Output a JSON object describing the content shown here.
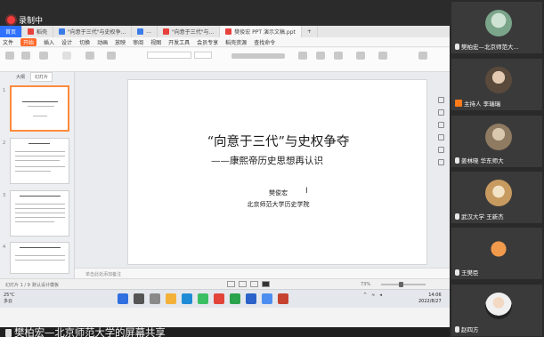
{
  "recording": {
    "label": "录制中"
  },
  "browser_tabs": [
    {
      "label": "首页",
      "icon_color": "#ffffff",
      "home": true
    },
    {
      "label": "稻壳",
      "icon_color": "#e8413c"
    },
    {
      "label": "\"向意于三代\"与史权争...",
      "icon_color": "#3b7be8"
    },
    {
      "label": "...",
      "icon_color": "#3b7be8"
    },
    {
      "label": "\"向意于三代\"与...",
      "icon_color": "#e8413c"
    },
    {
      "label": "樊俊宏 PPT 演示文稿.ppt",
      "icon_color": "#e8413c",
      "active": true
    }
  ],
  "menu": [
    "文件",
    "开始",
    "插入",
    "设计",
    "切换",
    "动画",
    "放映",
    "审阅",
    "视图",
    "开发工具",
    "会员专享",
    "稻壳资源",
    "查找命令"
  ],
  "menu_active": "开始",
  "thumbs_tabs": [
    "大纲",
    "幻灯片"
  ],
  "slide": {
    "title": "“向意于三代”与史权争夺",
    "subtitle": "——康熙帝历史思想再认识",
    "author": "樊俊宏",
    "affiliation": "北京师范大学历史学院"
  },
  "notes_placeholder": "单击此处添加备注",
  "status": {
    "slide_no": "幻灯片 1 / 9",
    "theme": "默认设计模板",
    "zoom": "73%"
  },
  "taskbar": {
    "weather_temp": "25°C",
    "weather_desc": "多云",
    "time": "14:06",
    "date": "2022/8/27"
  },
  "caption": "樊柏宏—北京师范大学的屏幕共享",
  "participants": [
    {
      "name": "樊柏宏—北京师范大...",
      "mic": true,
      "avatar_color": "#7aa58a"
    },
    {
      "name": "主持人 李瑞瑞",
      "host": true,
      "avatar_color": "#5a4a3c"
    },
    {
      "name": "姜林晓 华东师大",
      "mic": true,
      "avatar_color": "#8f7a62"
    },
    {
      "name": "武汉大学 王新杰",
      "mic": true,
      "avatar_color": "#c79a5f"
    },
    {
      "name": "王樊臣",
      "mic": true,
      "avatar_color": "#e07b2f"
    },
    {
      "name": "赵四方",
      "mic": true,
      "avatar_color": "#f0f0f0"
    }
  ]
}
